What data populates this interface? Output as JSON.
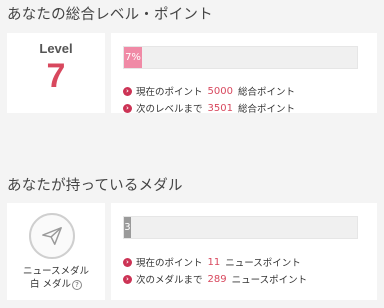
{
  "level_section": {
    "title": "あなたの総合レベル・ポイント",
    "level_label": "Level",
    "level_value": "7",
    "progress_text": "7%",
    "progress_fraction": 0.07,
    "current_points_label": "現在のポイント",
    "current_points_value": "5000",
    "current_points_unit": "総合ポイント",
    "next_level_label": "次のレベルまで",
    "next_level_value": "3501",
    "next_level_unit": "総合ポイント"
  },
  "medal_section": {
    "title": "あなたが持っているメダル",
    "medal_icon": "paper-plane-icon",
    "medal_name": "ニュースメダル",
    "medal_rank": "白 メダル",
    "help_glyph": "?",
    "progress_text": "3",
    "progress_fraction": 0.03,
    "current_points_label": "現在のポイント",
    "current_points_value": "11",
    "current_points_unit": "ニュースポイント",
    "next_medal_label": "次のメダルまで",
    "next_medal_value": "289",
    "next_medal_unit": "ニュースポイント"
  },
  "colors": {
    "accent": "#d8485e",
    "level_bar": "#f08aa6",
    "medal_bar": "#9a9a9a",
    "background": "#f4f4f4"
  }
}
